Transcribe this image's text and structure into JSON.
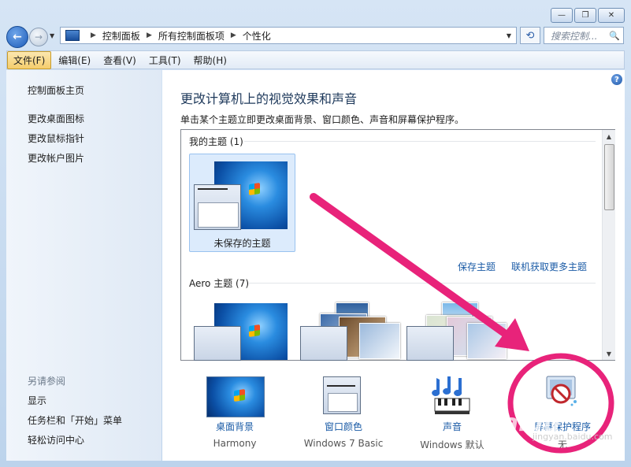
{
  "window": {
    "controls": {
      "minimize": "—",
      "maximize": "❐",
      "close": "✕"
    }
  },
  "nav": {
    "back": "←",
    "forward": "→",
    "breadcrumb": [
      "控制面板",
      "所有控制面板项",
      "个性化"
    ],
    "search_placeholder": "搜索控制...",
    "search_icon": "🔍",
    "refresh_icon": "⟲"
  },
  "menu": [
    "文件(F)",
    "编辑(E)",
    "查看(V)",
    "工具(T)",
    "帮助(H)"
  ],
  "sidebar": {
    "home": "控制面板主页",
    "links": [
      "更改桌面图标",
      "更改鼠标指针",
      "更改帐户图片"
    ],
    "see_also_header": "另请参阅",
    "see_also": [
      "显示",
      "任务栏和「开始」菜单",
      "轻松访问中心"
    ]
  },
  "main": {
    "help": "?",
    "title": "更改计算机上的视觉效果和声音",
    "subtitle": "单击某个主题立即更改桌面背景、窗口颜色、声音和屏幕保护程序。",
    "my_themes_header": "我的主题 (1)",
    "unsaved_theme": "未保存的主题",
    "save_theme": "保存主题",
    "get_more": "联机获取更多主题",
    "aero_header": "Aero 主题 (7)"
  },
  "bottom": [
    {
      "label": "桌面背景",
      "value": "Harmony"
    },
    {
      "label": "窗口颜色",
      "value": "Windows 7 Basic"
    },
    {
      "label": "声音",
      "value": "Windows 默认"
    },
    {
      "label": "屏幕保护程序",
      "value": "无"
    }
  ],
  "watermark": {
    "brand": "Baidu",
    "site": "jingyan.baidu.com"
  },
  "colors": {
    "annotation": "#e8237a",
    "link": "#1a5ba6",
    "title": "#1e395b"
  }
}
